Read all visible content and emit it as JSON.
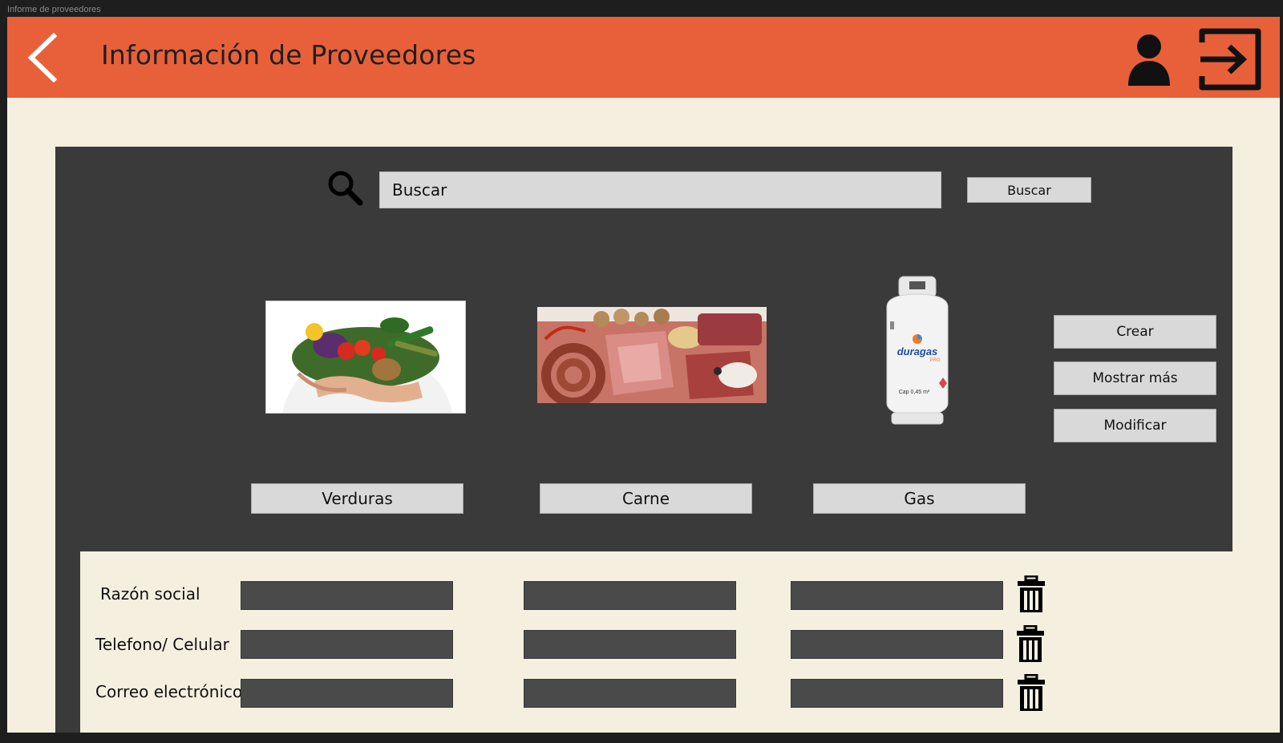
{
  "window": {
    "title": "Informe de proveedores"
  },
  "header": {
    "title": "Información de Proveedores",
    "back_icon": "chevron-left-icon",
    "user_icon": "user-icon",
    "logout_icon": "logout-icon"
  },
  "search": {
    "placeholder": "Buscar",
    "button_label": "Buscar",
    "icon": "search-icon"
  },
  "categories": [
    {
      "label": "Verduras",
      "image": "vegetables-photo"
    },
    {
      "label": "Carne",
      "image": "meat-photo"
    },
    {
      "label": "Gas",
      "image": "gas-cylinder-photo",
      "brand_text": "duragas",
      "brand_sub": "PRO",
      "capacity_text": "Cap 0,45 m³"
    }
  ],
  "actions": {
    "create": "Crear",
    "show_more": "Mostrar más",
    "modify": "Modificar"
  },
  "details": {
    "rows": [
      {
        "label": "Razón social"
      },
      {
        "label": "Telefono/ Celular"
      },
      {
        "label": "Correo electrónico"
      }
    ]
  },
  "colors": {
    "header": "#e8603a",
    "background": "#f4efdf",
    "panel": "#3a3a3a",
    "field": "#4a4a4a",
    "button": "#d9d9d9"
  }
}
